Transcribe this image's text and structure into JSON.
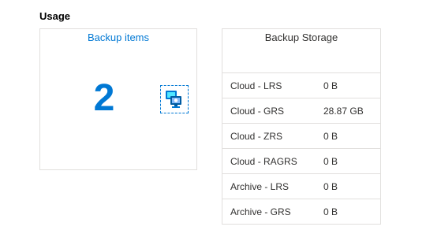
{
  "section": {
    "title": "Usage"
  },
  "backup_items_tile": {
    "title": "Backup items",
    "count": "2",
    "icon": "backup-server-icon",
    "accent_color": "#0078d4"
  },
  "backup_storage": {
    "title": "Backup Storage",
    "rows": [
      {
        "name": "Cloud - LRS",
        "value": "0 B"
      },
      {
        "name": "Cloud - GRS",
        "value": "28.87 GB"
      },
      {
        "name": "Cloud - ZRS",
        "value": "0 B"
      },
      {
        "name": "Cloud - RAGRS",
        "value": "0 B"
      },
      {
        "name": "Archive - LRS",
        "value": "0 B"
      },
      {
        "name": "Archive - GRS",
        "value": "0 B"
      }
    ]
  }
}
